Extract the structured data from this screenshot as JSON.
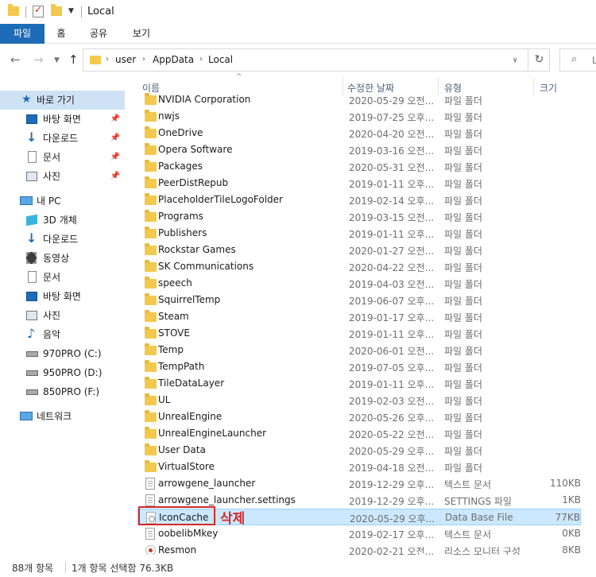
{
  "window": {
    "title": "Local"
  },
  "ribbon": {
    "tabs": [
      "파일",
      "홈",
      "공유",
      "보기"
    ]
  },
  "address": {
    "crumbs": [
      "user",
      "AppData",
      "Local"
    ]
  },
  "search": {
    "placeholder": "L"
  },
  "nav": {
    "quick_access": "바로 가기",
    "quick_items": [
      "바탕 화면",
      "다운로드",
      "문서",
      "사진"
    ],
    "this_pc": "내 PC",
    "pc_items": [
      "3D 개체",
      "다운로드",
      "동영상",
      "문서",
      "바탕 화면",
      "사진",
      "음악",
      "970PRO (C:)",
      "950PRO (D:)",
      "850PRO (F:)"
    ],
    "network": "네트워크"
  },
  "columns": {
    "name": "이름",
    "date": "수정한 날짜",
    "type": "유형",
    "size": "크기"
  },
  "files": [
    {
      "name": "NVIDIA Corporation",
      "date": "2020-05-29 오전...",
      "type": "파일 폴더",
      "size": "",
      "icon": "folder"
    },
    {
      "name": "nwjs",
      "date": "2019-07-25 오후...",
      "type": "파일 폴더",
      "size": "",
      "icon": "folder"
    },
    {
      "name": "OneDrive",
      "date": "2020-04-20 오전...",
      "type": "파일 폴더",
      "size": "",
      "icon": "folder"
    },
    {
      "name": "Opera Software",
      "date": "2019-03-16 오전...",
      "type": "파일 폴더",
      "size": "",
      "icon": "folder"
    },
    {
      "name": "Packages",
      "date": "2020-05-31 오전...",
      "type": "파일 폴더",
      "size": "",
      "icon": "folder"
    },
    {
      "name": "PeerDistRepub",
      "date": "2019-01-11 오후...",
      "type": "파일 폴더",
      "size": "",
      "icon": "folder"
    },
    {
      "name": "PlaceholderTileLogoFolder",
      "date": "2019-02-14 오후...",
      "type": "파일 폴더",
      "size": "",
      "icon": "folder"
    },
    {
      "name": "Programs",
      "date": "2019-03-15 오전...",
      "type": "파일 폴더",
      "size": "",
      "icon": "folder"
    },
    {
      "name": "Publishers",
      "date": "2019-01-11 오후...",
      "type": "파일 폴더",
      "size": "",
      "icon": "folder"
    },
    {
      "name": "Rockstar Games",
      "date": "2020-01-27 오전...",
      "type": "파일 폴더",
      "size": "",
      "icon": "folder"
    },
    {
      "name": "SK Communications",
      "date": "2020-04-22 오전...",
      "type": "파일 폴더",
      "size": "",
      "icon": "folder"
    },
    {
      "name": "speech",
      "date": "2019-04-03 오전...",
      "type": "파일 폴더",
      "size": "",
      "icon": "folder"
    },
    {
      "name": "SquirrelTemp",
      "date": "2019-06-07 오후...",
      "type": "파일 폴더",
      "size": "",
      "icon": "folder"
    },
    {
      "name": "Steam",
      "date": "2019-01-17 오후...",
      "type": "파일 폴더",
      "size": "",
      "icon": "folder"
    },
    {
      "name": "STOVE",
      "date": "2019-01-11 오후...",
      "type": "파일 폴더",
      "size": "",
      "icon": "folder"
    },
    {
      "name": "Temp",
      "date": "2020-06-01 오전...",
      "type": "파일 폴더",
      "size": "",
      "icon": "folder"
    },
    {
      "name": "TempPath",
      "date": "2019-07-05 오후...",
      "type": "파일 폴더",
      "size": "",
      "icon": "folder"
    },
    {
      "name": "TileDataLayer",
      "date": "2019-01-11 오후...",
      "type": "파일 폴더",
      "size": "",
      "icon": "folder"
    },
    {
      "name": "UL",
      "date": "2019-02-03 오전...",
      "type": "파일 폴더",
      "size": "",
      "icon": "folder"
    },
    {
      "name": "UnrealEngine",
      "date": "2020-05-26 오후...",
      "type": "파일 폴더",
      "size": "",
      "icon": "folder"
    },
    {
      "name": "UnrealEngineLauncher",
      "date": "2020-05-22 오전...",
      "type": "파일 폴더",
      "size": "",
      "icon": "folder"
    },
    {
      "name": "User Data",
      "date": "2020-05-29 오후...",
      "type": "파일 폴더",
      "size": "",
      "icon": "folder"
    },
    {
      "name": "VirtualStore",
      "date": "2019-04-18 오전...",
      "type": "파일 폴더",
      "size": "",
      "icon": "folder"
    },
    {
      "name": "arrowgene_launcher",
      "date": "2019-12-29 오후...",
      "type": "텍스트 문서",
      "size": "110KB",
      "icon": "doc"
    },
    {
      "name": "arrowgene_launcher.settings",
      "date": "2019-12-29 오후...",
      "type": "SETTINGS 파일",
      "size": "1KB",
      "icon": "doc"
    },
    {
      "name": "IconCache",
      "date": "2020-05-29 오후...",
      "type": "Data Base File",
      "size": "77KB",
      "icon": "db",
      "selected": true
    },
    {
      "name": "oobelibMkey",
      "date": "2019-02-17 오후...",
      "type": "텍스트 문서",
      "size": "0KB",
      "icon": "doc"
    },
    {
      "name": "Resmon",
      "date": "2020-02-21 오전...",
      "type": "리소스 모니터 구성",
      "size": "8KB",
      "icon": "res"
    }
  ],
  "annotation": {
    "label": "삭제",
    "color": "#d12b2b"
  },
  "status": {
    "count": "88개 항목",
    "selection": "1개 항목 선택함 76.3KB"
  },
  "colors": {
    "accent": "#1e6bb8",
    "selection": "#cce8ff",
    "folder": "#f2c94c"
  }
}
